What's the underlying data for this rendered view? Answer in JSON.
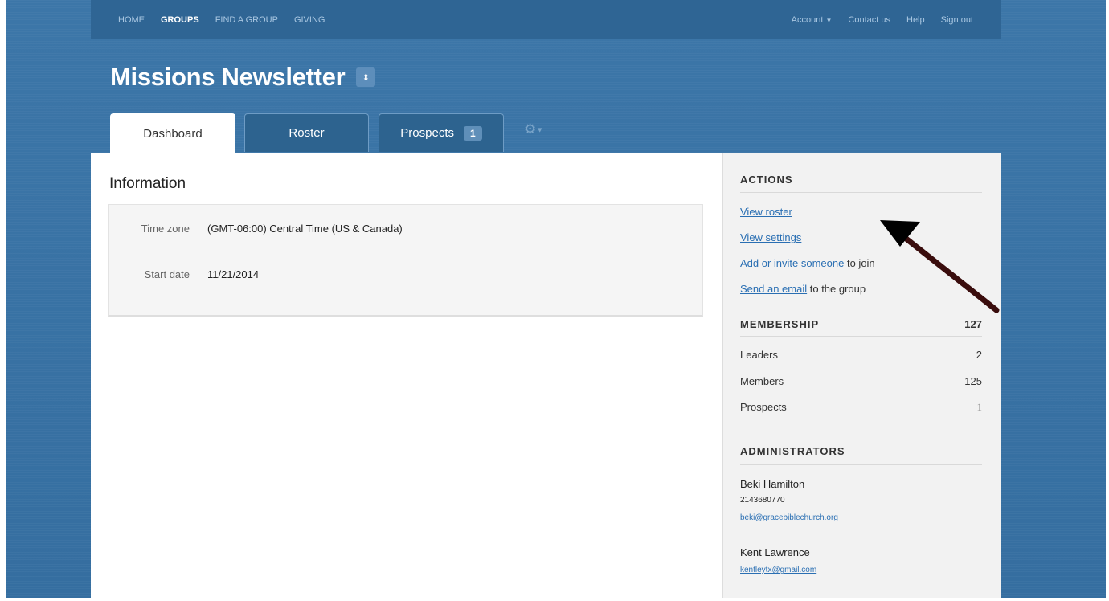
{
  "topnav": {
    "left": [
      "HOME",
      "GROUPS",
      "FIND A GROUP",
      "GIVING"
    ],
    "active_index": 1,
    "account": "Account",
    "contact": "Contact us",
    "help": "Help",
    "signout": "Sign out"
  },
  "page": {
    "title": "Missions Newsletter",
    "toggle_icon": "sort-icon"
  },
  "tabs": [
    {
      "label": "Dashboard",
      "active": true
    },
    {
      "label": "Roster"
    },
    {
      "label": "Prospects",
      "badge": "1"
    }
  ],
  "gear_icon": "gear-icon",
  "information": {
    "heading": "Information",
    "rows": [
      {
        "label": "Time zone",
        "value": "(GMT-06:00) Central Time (US & Canada)"
      },
      {
        "label": "Start date",
        "value": "11/21/2014"
      }
    ]
  },
  "actions": {
    "heading": "ACTIONS",
    "view_roster": "View roster",
    "view_settings": "View settings",
    "add_invite": "Add or invite someone",
    "add_invite_suffix": " to join",
    "send_email": "Send an email",
    "send_email_suffix": " to the group"
  },
  "membership": {
    "heading": "MEMBERSHIP",
    "total": "127",
    "rows": [
      {
        "label": "Leaders",
        "value": "2"
      },
      {
        "label": "Members",
        "value": "125"
      },
      {
        "label": "Prospects",
        "value": "1"
      }
    ]
  },
  "administrators": {
    "heading": "ADMINISTRATORS",
    "people": [
      {
        "name": "Beki Hamilton",
        "phone": "2143680770",
        "email": "beki@gracebiblechurch.org"
      },
      {
        "name": "Kent Lawrence",
        "email": "kentleytx@gmail.com"
      }
    ]
  },
  "colors": {
    "background": "#3a73a6",
    "link": "#2a6fb3",
    "arrow": "#3a0d0d"
  }
}
